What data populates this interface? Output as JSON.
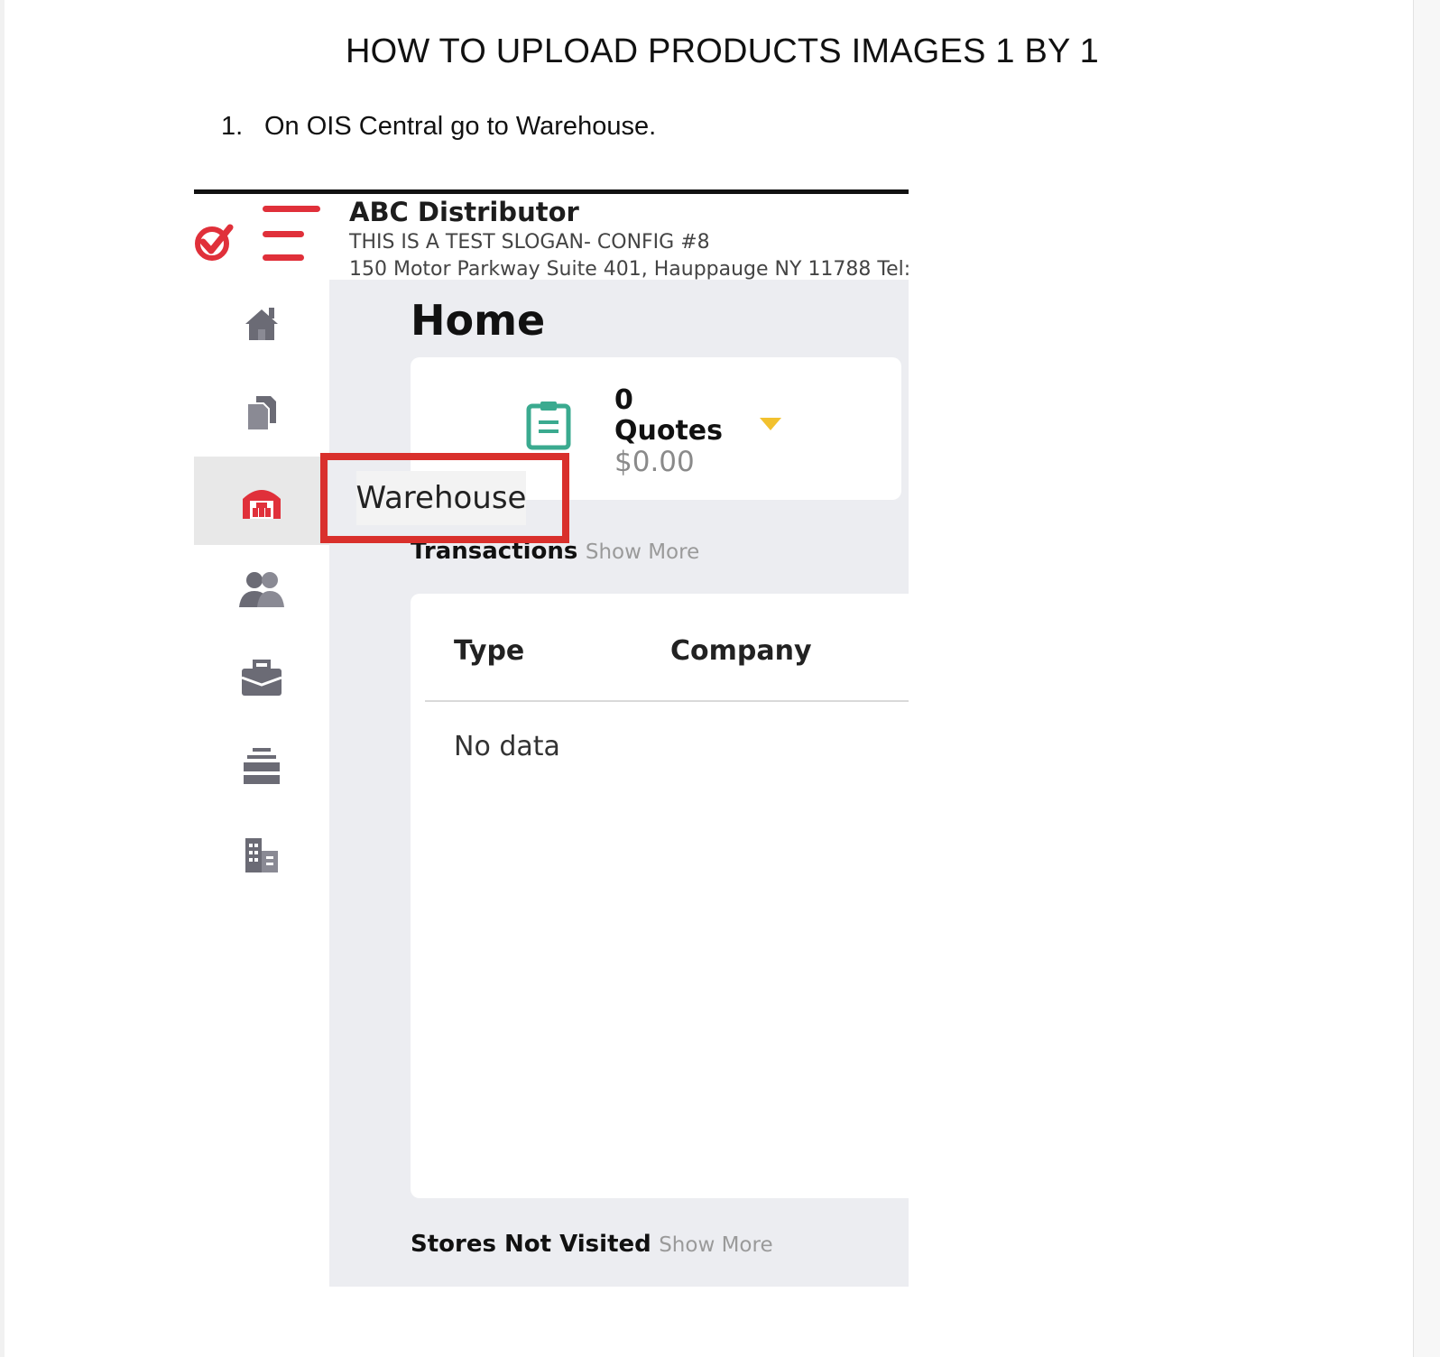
{
  "document": {
    "title": "HOW TO UPLOAD PRODUCTS IMAGES 1 BY 1",
    "step_number": "1.",
    "step_text": "On OIS Central go to Warehouse."
  },
  "app": {
    "company_name": "ABC Distributor",
    "slogan": "THIS IS A TEST SLOGAN- CONFIG #8",
    "address": "150 Motor Parkway Suite 401, Hauppauge NY 11788 Tel:",
    "brand_color": "#e0303a",
    "sidebar": {
      "items": [
        {
          "icon": "home-icon",
          "active": false
        },
        {
          "icon": "documents-icon",
          "active": false
        },
        {
          "icon": "warehouse-icon",
          "active": true
        },
        {
          "icon": "customers-icon",
          "active": false
        },
        {
          "icon": "briefcase-icon",
          "active": false
        },
        {
          "icon": "inventory-stack-icon",
          "active": false
        },
        {
          "icon": "buildings-icon",
          "active": false
        }
      ]
    },
    "tooltip": "Warehouse",
    "page_title": "Home",
    "quotes_card": {
      "count": "0",
      "label": "Quotes",
      "amount": "$0.00",
      "icon": "clipboard-icon"
    },
    "transactions": {
      "title": "Transactions",
      "show_more": "Show More",
      "columns": [
        "Type",
        "Company"
      ],
      "empty_text": "No data"
    },
    "stores_not_visited": {
      "title": "Stores Not Visited",
      "show_more": "Show More"
    }
  }
}
